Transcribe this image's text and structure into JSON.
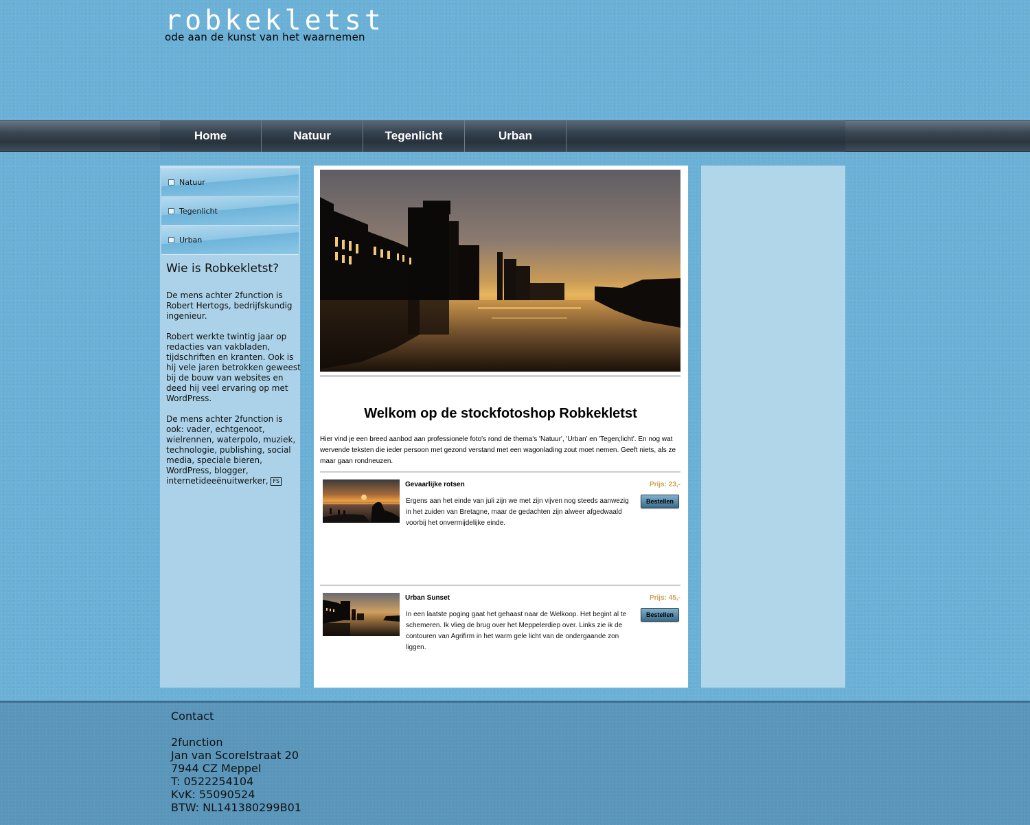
{
  "header": {
    "site_title": "robkekletst",
    "tagline": "ode aan de kunst van het waarnemen"
  },
  "nav": {
    "items": [
      {
        "label": "Home"
      },
      {
        "label": "Natuur"
      },
      {
        "label": "Tegenlicht"
      },
      {
        "label": "Urban"
      }
    ]
  },
  "sidebar": {
    "items": [
      {
        "label": "Natuur"
      },
      {
        "label": "Tegenlicht"
      },
      {
        "label": "Urban"
      }
    ],
    "about": {
      "title": "Wie is Robkekletst?",
      "p1": "De mens achter 2function is Robert Hertogs, bedrijfskundig  ingenieur.",
      "p2": "Robert werkte twintig jaar op redacties van vakbladen,  tijdschriften en kranten. Ook  is hij vele jaren betrokken geweest bij de bouw van  websites en deed hij veel ervaring op met WordPress.",
      "p3": "De mens achter 2function is ook: vader, echtgenoot, wielrennen, waterpolo, muziek, technologie, publishing, social media,  speciale bieren, WordPress, blogger, internetideeënuitwerker,",
      "icon_text": "FS"
    }
  },
  "main": {
    "heading": "Welkom op de stockfotoshop Robkekletst",
    "intro": "Hier vind je een breed aanbod aan professionele foto's rond de thema's 'Natuur', 'Urban' en 'Tegen;licht'. En nog wat wervende teksten die ieder persoon met gezond verstand met een wagonlading zout moet nemen. Geeft niets, als ze maar gaan rondneuzen.",
    "products": [
      {
        "title": "Gevaarlijke rotsen",
        "price": "Prijs: 23,-",
        "description": "Ergens aan het einde van juli zijn we met zijn vijven nog steeds aanwezig in het zuiden van Bretagne, maar de gedachten zijn alweer afgedwaald voorbij het onvermijdelijke einde.",
        "button": "Bestellen"
      },
      {
        "title": "Urban Sunset",
        "price": "Prijs: 45,-",
        "description": "In een laatste poging gaat het gehaast naar de Welkoop. Het begint al te schemeren. Ik vlieg de brug over het Meppelerdiep over. Links zie ik de contouren van Agrifirm in het warm gele licht van de ondergaande zon liggen.",
        "button": "Bestellen"
      }
    ]
  },
  "footer": {
    "title": "Contact",
    "lines": [
      "2function",
      "Jan van Scorelstraat 20",
      "7944 CZ Meppel",
      "T: 0522254104",
      "KvK: 55090524",
      "BTW: NL141380299B01"
    ]
  },
  "colors": {
    "background": "#6bb0d6",
    "price": "#c9a154",
    "footer": "#5a95ba"
  }
}
